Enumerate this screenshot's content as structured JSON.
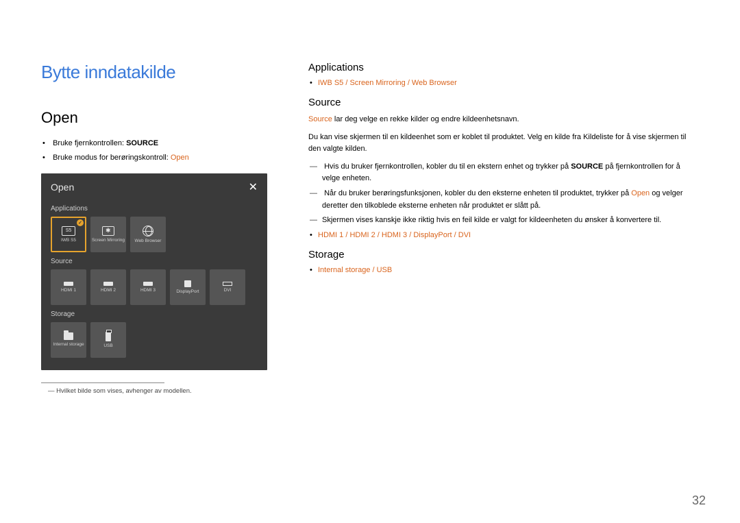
{
  "chapter_title": "Bytte inndatakilde",
  "left": {
    "h1": "Open",
    "bullet1_prefix": "Bruke fjernkontrollen: ",
    "bullet1_bold": "SOURCE",
    "bullet2_prefix": "Bruke modus for berøringskontroll: ",
    "bullet2_orange": "Open",
    "panel": {
      "title": "Open",
      "section_apps": "Applications",
      "tiles_apps": [
        {
          "label": "IWB S5",
          "icon": "s5"
        },
        {
          "label": "Screen Mirroring",
          "icon": "mirror"
        },
        {
          "label": "Web Browser",
          "icon": "globe"
        }
      ],
      "section_source": "Source",
      "tiles_source": [
        {
          "label": "HDMI 1",
          "icon": "hdmi"
        },
        {
          "label": "HDMI 2",
          "icon": "hdmi"
        },
        {
          "label": "HDMI 3",
          "icon": "hdmi"
        },
        {
          "label": "DisplayPort",
          "icon": "dp"
        },
        {
          "label": "DVI",
          "icon": "dvi"
        }
      ],
      "section_storage": "Storage",
      "tiles_storage": [
        {
          "label": "Internal storage",
          "icon": "folder"
        },
        {
          "label": "USB",
          "icon": "usb"
        }
      ]
    },
    "footnote": "Hvilket bilde som vises, avhenger av modellen."
  },
  "right": {
    "apps_h": "Applications",
    "apps_items": "IWB S5 / Screen Mirroring / Web Browser",
    "source_h": "Source",
    "source_p1_orange": "Source",
    "source_p1_rest": " lar deg velge en rekke kilder og endre kildeenhetsnavn.",
    "source_p2": "Du kan vise skjermen til en kildeenhet som er koblet til produktet. Velg en kilde fra Kildeliste for å vise skjermen til den valgte kilden.",
    "dash1_a": "Hvis du bruker fjernkontrollen, kobler du til en ekstern enhet og trykker på ",
    "dash1_bold": "SOURCE",
    "dash1_b": " på fjernkontrollen for å velge enheten.",
    "dash2_a": "Når du bruker berøringsfunksjonen, kobler du den eksterne enheten til produktet, trykker på ",
    "dash2_orange": "Open",
    "dash2_b": " og velger deretter den tilkoblede eksterne enheten når produktet er slått på.",
    "dash3": "Skjermen vises kanskje ikke riktig hvis en feil kilde er valgt for kildeenheten du ønsker å konvertere til.",
    "hdmi_items": "HDMI 1 / HDMI 2 / HDMI 3 / DisplayPort / DVI",
    "storage_h": "Storage",
    "storage_items": "Internal storage / USB"
  },
  "page_number": "32"
}
